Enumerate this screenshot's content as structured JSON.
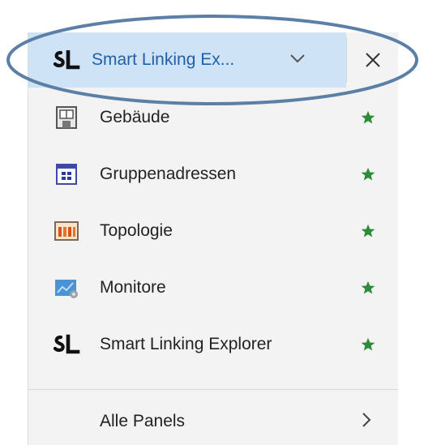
{
  "panel_switcher": {
    "selected_label": "Smart Linking Ex...",
    "selected_icon": "smart-linking-logo-icon",
    "chevron_icon": "chevron-down-icon",
    "close_icon": "close-icon"
  },
  "panels": [
    {
      "label": "Gebäude",
      "icon": "building-icon",
      "favorite": true
    },
    {
      "label": "Gruppenadressen",
      "icon": "group-addresses-icon",
      "favorite": true
    },
    {
      "label": "Topologie",
      "icon": "topology-icon",
      "favorite": true
    },
    {
      "label": "Monitore",
      "icon": "monitor-icon",
      "favorite": true
    },
    {
      "label": "Smart Linking Explorer",
      "icon": "smart-linking-logo-icon",
      "favorite": true
    }
  ],
  "all_panels": {
    "label": "Alle Panels",
    "chevron_icon": "chevron-right-icon"
  },
  "colors": {
    "selected_background": "#cfe3f7",
    "selected_text": "#1f5fa8",
    "favorite_star": "#2e8b3a",
    "annotation_ellipse": "#5b7fa6"
  }
}
